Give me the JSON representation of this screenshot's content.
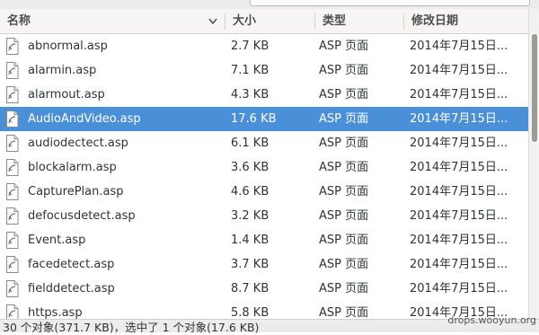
{
  "columns": {
    "name": "名称",
    "size": "大小",
    "type": "类型",
    "date": "修改日期"
  },
  "files": [
    {
      "name": "abnormal.asp",
      "size": "2.7 KB",
      "type": "ASP 页面",
      "date": "2014年7月15日...",
      "selected": false
    },
    {
      "name": "alarmin.asp",
      "size": "7.1 KB",
      "type": "ASP 页面",
      "date": "2014年7月15日...",
      "selected": false
    },
    {
      "name": "alarmout.asp",
      "size": "4.3 KB",
      "type": "ASP 页面",
      "date": "2014年7月15日...",
      "selected": false
    },
    {
      "name": "AudioAndVideo.asp",
      "size": "17.6 KB",
      "type": "ASP 页面",
      "date": "2014年7月15日...",
      "selected": true
    },
    {
      "name": "audiodectect.asp",
      "size": "6.1 KB",
      "type": "ASP 页面",
      "date": "2014年7月15日...",
      "selected": false
    },
    {
      "name": "blockalarm.asp",
      "size": "3.6 KB",
      "type": "ASP 页面",
      "date": "2014年7月15日...",
      "selected": false
    },
    {
      "name": "CapturePlan.asp",
      "size": "4.6 KB",
      "type": "ASP 页面",
      "date": "2014年7月15日...",
      "selected": false
    },
    {
      "name": "defocusdetect.asp",
      "size": "3.2 KB",
      "type": "ASP 页面",
      "date": "2014年7月15日...",
      "selected": false
    },
    {
      "name": "Event.asp",
      "size": "1.4 KB",
      "type": "ASP 页面",
      "date": "2014年7月15日...",
      "selected": false
    },
    {
      "name": "facedetect.asp",
      "size": "3.7 KB",
      "type": "ASP 页面",
      "date": "2014年7月15日...",
      "selected": false
    },
    {
      "name": "fielddetect.asp",
      "size": "8.7 KB",
      "type": "ASP 页面",
      "date": "2014年7月15日...",
      "selected": false
    },
    {
      "name": "https.asp",
      "size": "5.8 KB",
      "type": "ASP 页面",
      "date": "2014年7月15日...",
      "selected": false
    }
  ],
  "icons": {
    "sort": "chevron-down-icon",
    "file": "file-icon"
  },
  "status": {
    "text": "30 个对象(371.7 KB)，选中了 1 个对象(17.6 KB)"
  },
  "watermark": "drops.wooyun.org",
  "colors": {
    "selection": "#4a90d9",
    "header_bg": "#f6f5f4"
  }
}
